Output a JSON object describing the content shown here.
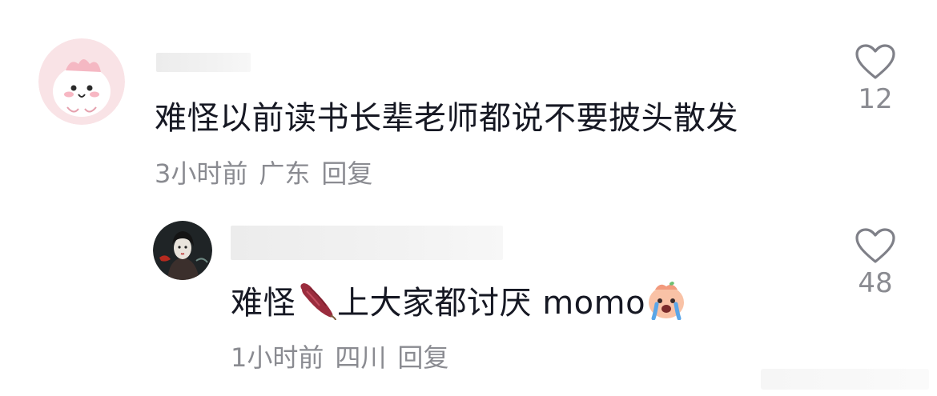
{
  "comments": [
    {
      "text": "难怪以前读书长辈老师都说不要披头散发",
      "time": "3小时前",
      "location": "广东",
      "reply_label": "回复",
      "likes": "12",
      "avatar_icon": "pink-cartoon-avatar"
    },
    {
      "text_before": "难怪",
      "emoji_1": "sweet-potato-emoji",
      "text_middle": "上大家都讨厌 momo",
      "emoji_2": "crying-face-emoji",
      "time": "1小时前",
      "location": "四川",
      "reply_label": "回复",
      "likes": "48",
      "avatar_icon": "dark-portrait-avatar"
    }
  ],
  "colors": {
    "text": "#161823",
    "meta": "#8a8b91",
    "heart": "#7f8088"
  }
}
